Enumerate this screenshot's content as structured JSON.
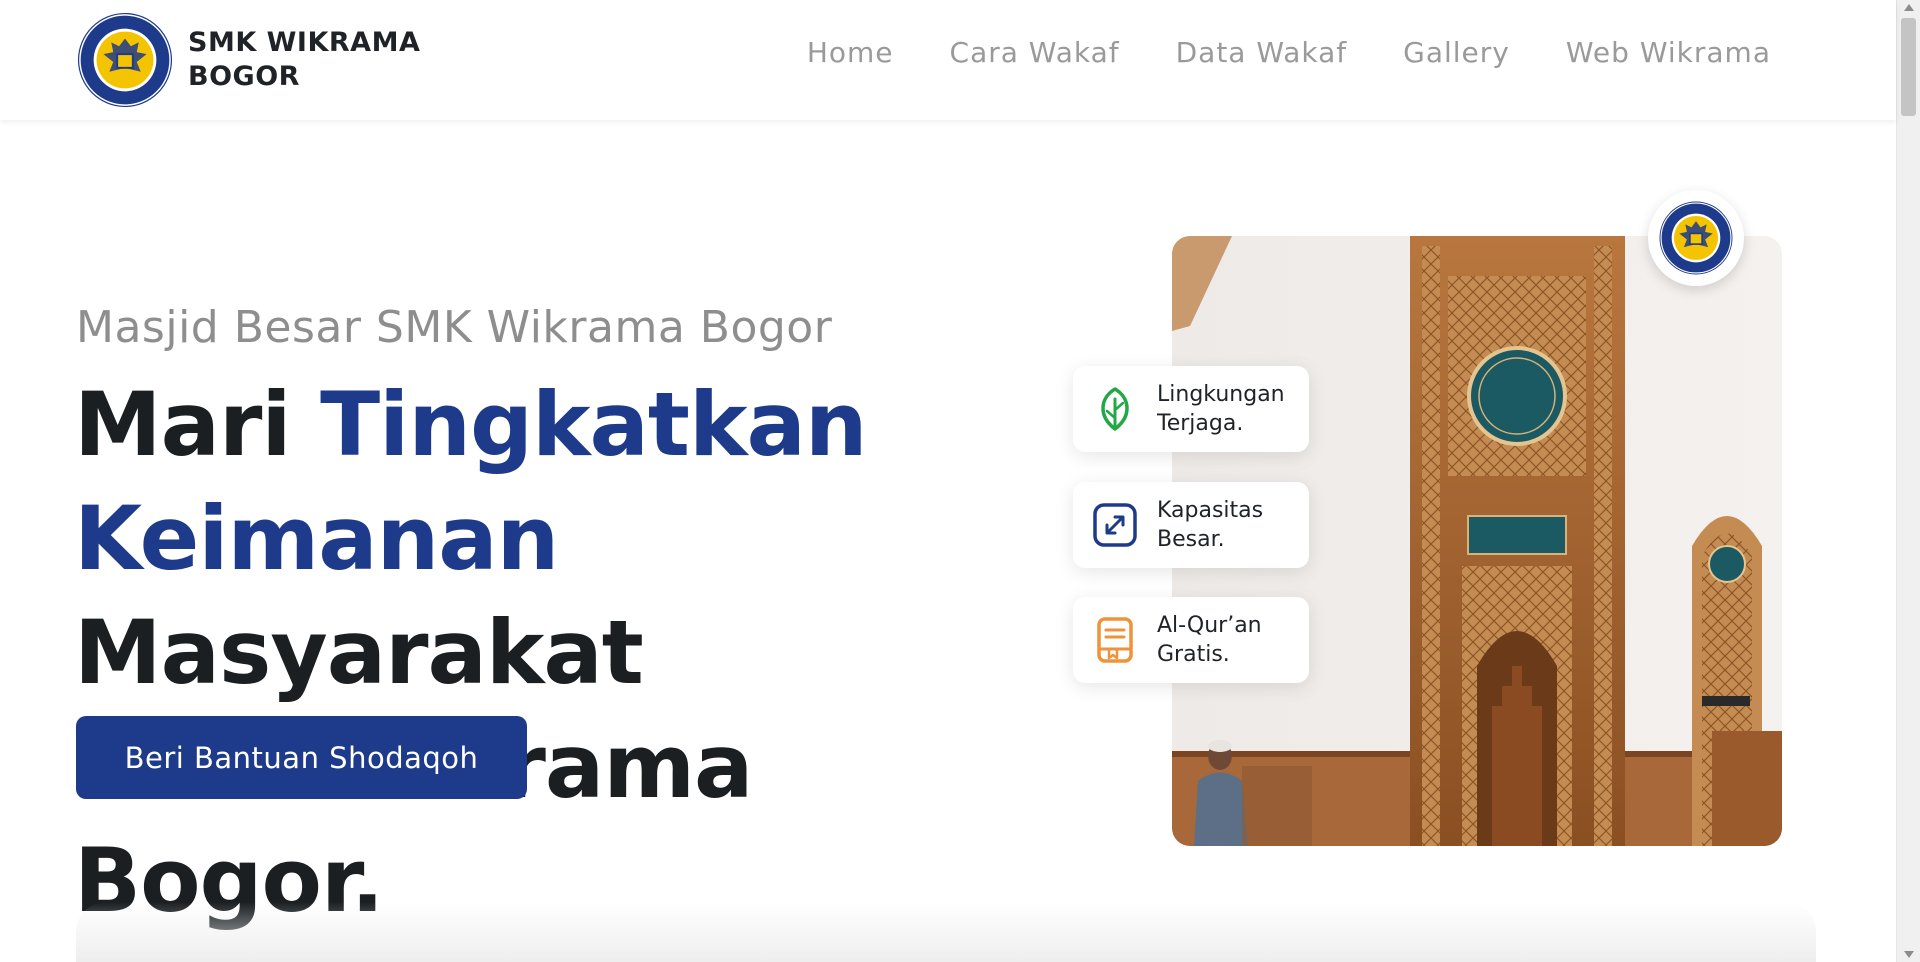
{
  "brand": {
    "name_line1": "SMK WIKRAMA",
    "name_line2": "BOGOR",
    "logo_icon": "school-crest-icon",
    "logo_text_top": "SMK WIKRAMA",
    "logo_text_bottom": "KOTA BOGOR"
  },
  "nav": {
    "items": [
      {
        "label": "Home"
      },
      {
        "label": "Cara Wakaf"
      },
      {
        "label": "Data Wakaf"
      },
      {
        "label": "Gallery"
      },
      {
        "label": "Web Wikrama"
      }
    ]
  },
  "hero": {
    "subtitle": "Masjid Besar SMK Wikrama Bogor",
    "headline_part1": "Mari ",
    "headline_accent1": "Tingkatkan",
    "headline_accent2": "Keimanan",
    "headline_part2": " Masyarakat",
    "headline_part3": "SMK Wikrama Bogor.",
    "cta_label": "Beri Bantuan Shodaqoh"
  },
  "features": [
    {
      "icon": "leaf-icon",
      "line1": "Lingkungan",
      "line2": "Terjaga."
    },
    {
      "icon": "expand-icon",
      "line1": "Kapasitas",
      "line2": "Besar."
    },
    {
      "icon": "book-icon",
      "line1": "Al-Qur’an",
      "line2": "Gratis."
    }
  ],
  "colors": {
    "accent": "#1e3a8a",
    "text_dark": "#1b1f22",
    "text_muted": "#8e8e8e",
    "leaf_green": "#22a845",
    "book_orange": "#f0923a"
  },
  "image": {
    "subject": "mosque-interior-photo"
  }
}
